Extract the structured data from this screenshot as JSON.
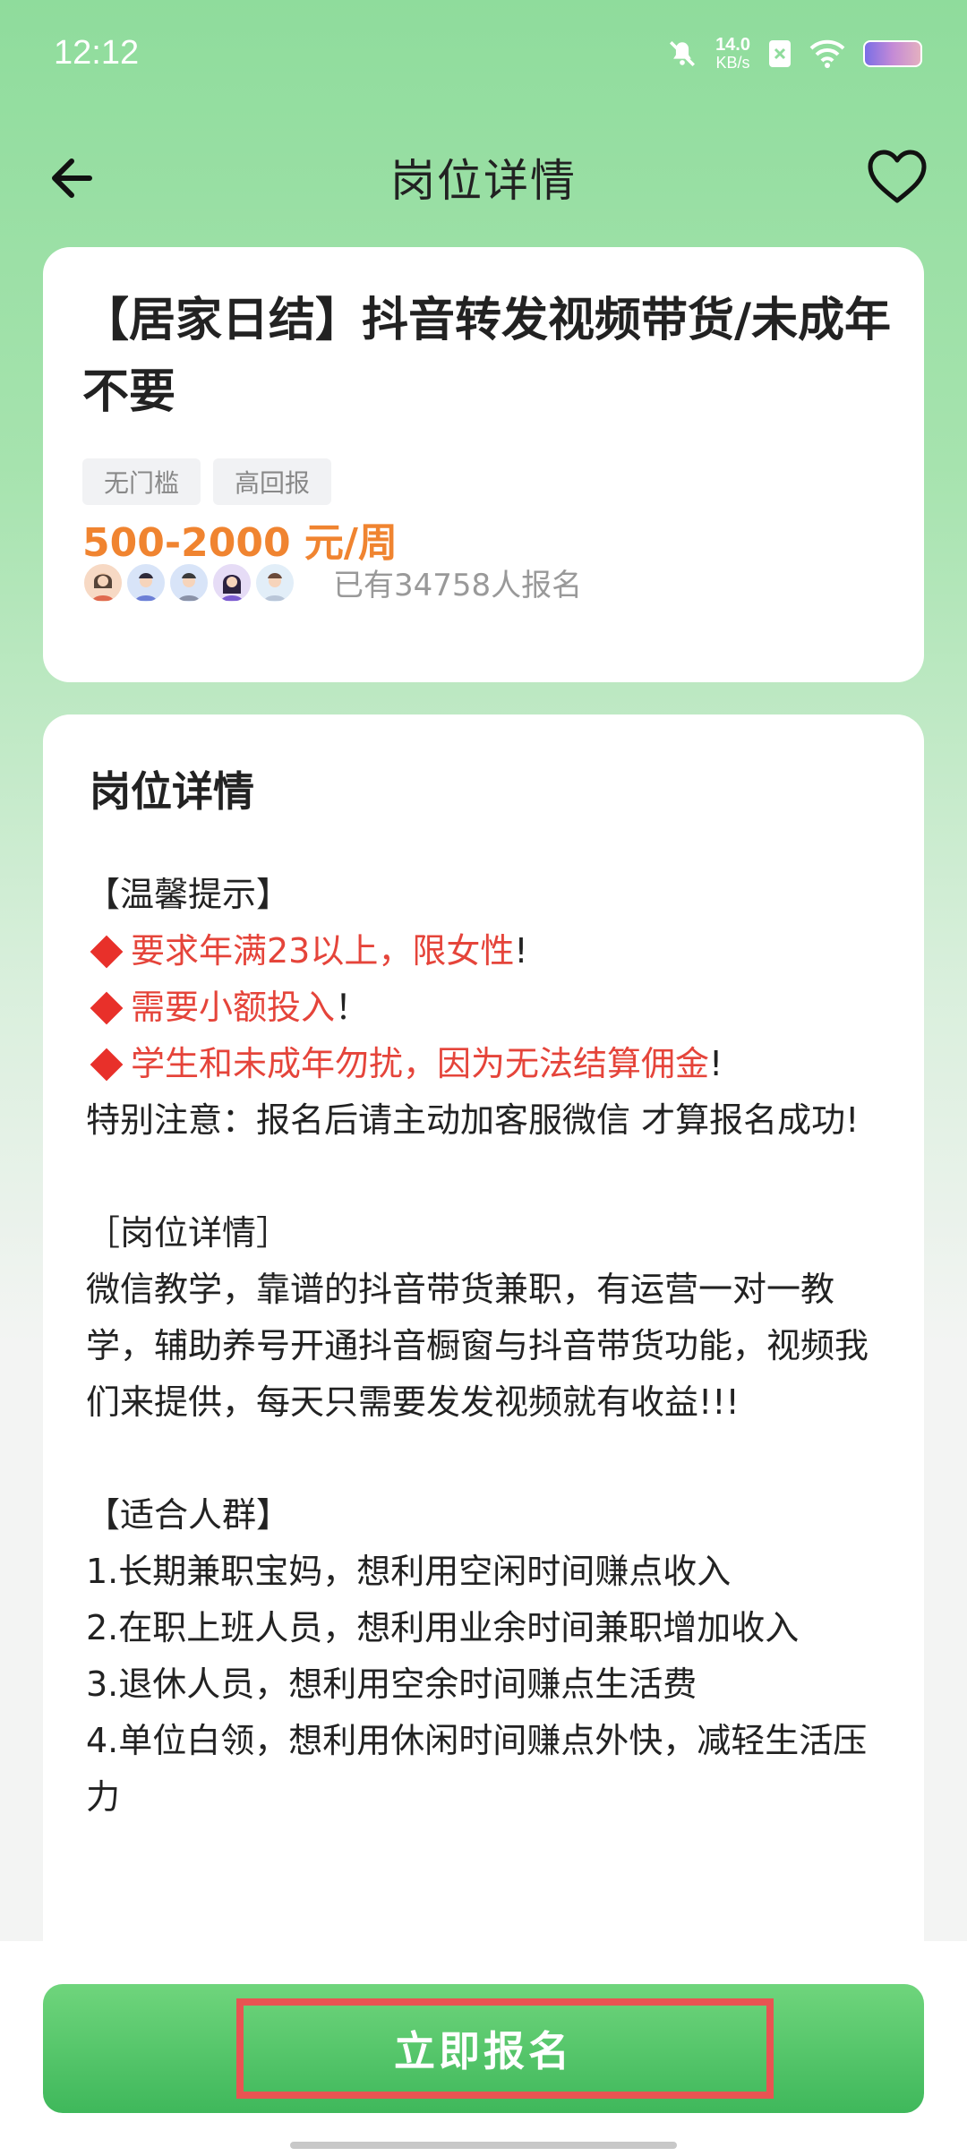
{
  "status_bar": {
    "time": "12:12",
    "net_speed": "14.0",
    "net_unit": "KB/s"
  },
  "nav": {
    "title": "岗位详情"
  },
  "job": {
    "title": "【居家日结】抖音转发视频带货/未成年不要",
    "tags": [
      "无门槛",
      "高回报"
    ],
    "salary": "500-2000 元/周",
    "applicants_text": "已有34758人报名"
  },
  "detail": {
    "heading": "岗位详情",
    "tip_header": "【温馨提示】",
    "tips": [
      {
        "text": "要求年满23以上，限女性",
        "suffix": "!"
      },
      {
        "text": "需要小额投入",
        "suffix": "！"
      },
      {
        "text": "学生和未成年勿扰，因为无法结算佣金",
        "suffix": "!"
      }
    ],
    "note": "特别注意：报名后请主动加客服微信 才算报名成功!",
    "job_header": "［岗位详情］",
    "job_desc": "微信教学，靠谱的抖音带货兼职，有运营一对一教学，辅助养号开通抖音橱窗与抖音带货功能，视频我们来提供，每天只需要发发视频就有收益!!!",
    "audience_header": "【适合人群】",
    "audience": [
      "1.长期兼职宝妈，想利用空闲时间赚点收入",
      "2.在职上班人员，想利用业余时间兼职增加收入",
      "3.退休人员，想利用空余时间赚点生活费",
      "4.单位白领，想利用休闲时间赚点外快，减轻生活压力"
    ]
  },
  "actions": {
    "apply_label": "立即报名"
  },
  "colors": {
    "accent_green": "#4cc265",
    "salary_orange": "#f08430",
    "warning_red": "#e5443a",
    "highlight_red": "#e85452"
  }
}
